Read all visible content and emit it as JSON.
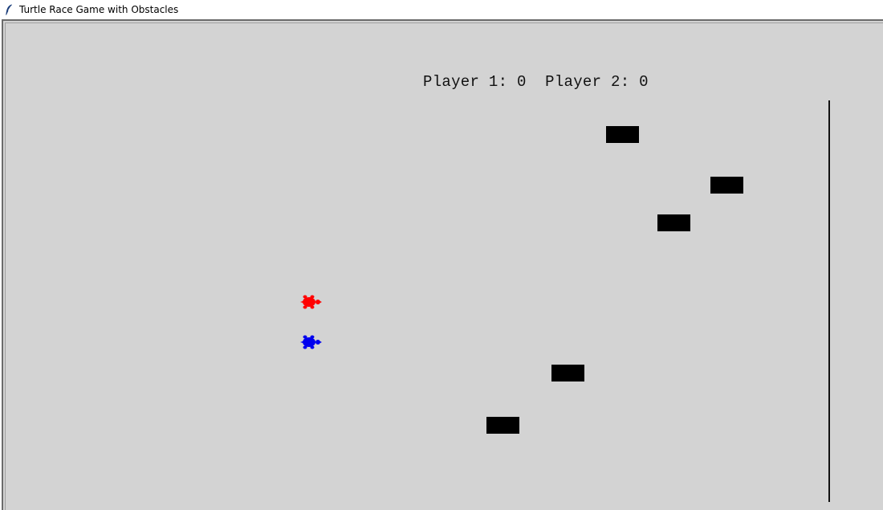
{
  "window": {
    "title": "Turtle Race Game with Obstacles",
    "icon": "feather-icon"
  },
  "game": {
    "background_color": "#d3d3d3",
    "score_text": "Player 1: 0  Player 2: 0",
    "players": [
      {
        "name": "Player 1",
        "score": 0,
        "color": "#ff0000"
      },
      {
        "name": "Player 2",
        "score": 0,
        "color": "#0000ee"
      }
    ],
    "obstacle_color": "#000000",
    "obstacle_count": 5,
    "finish_line_color": "#111111"
  }
}
